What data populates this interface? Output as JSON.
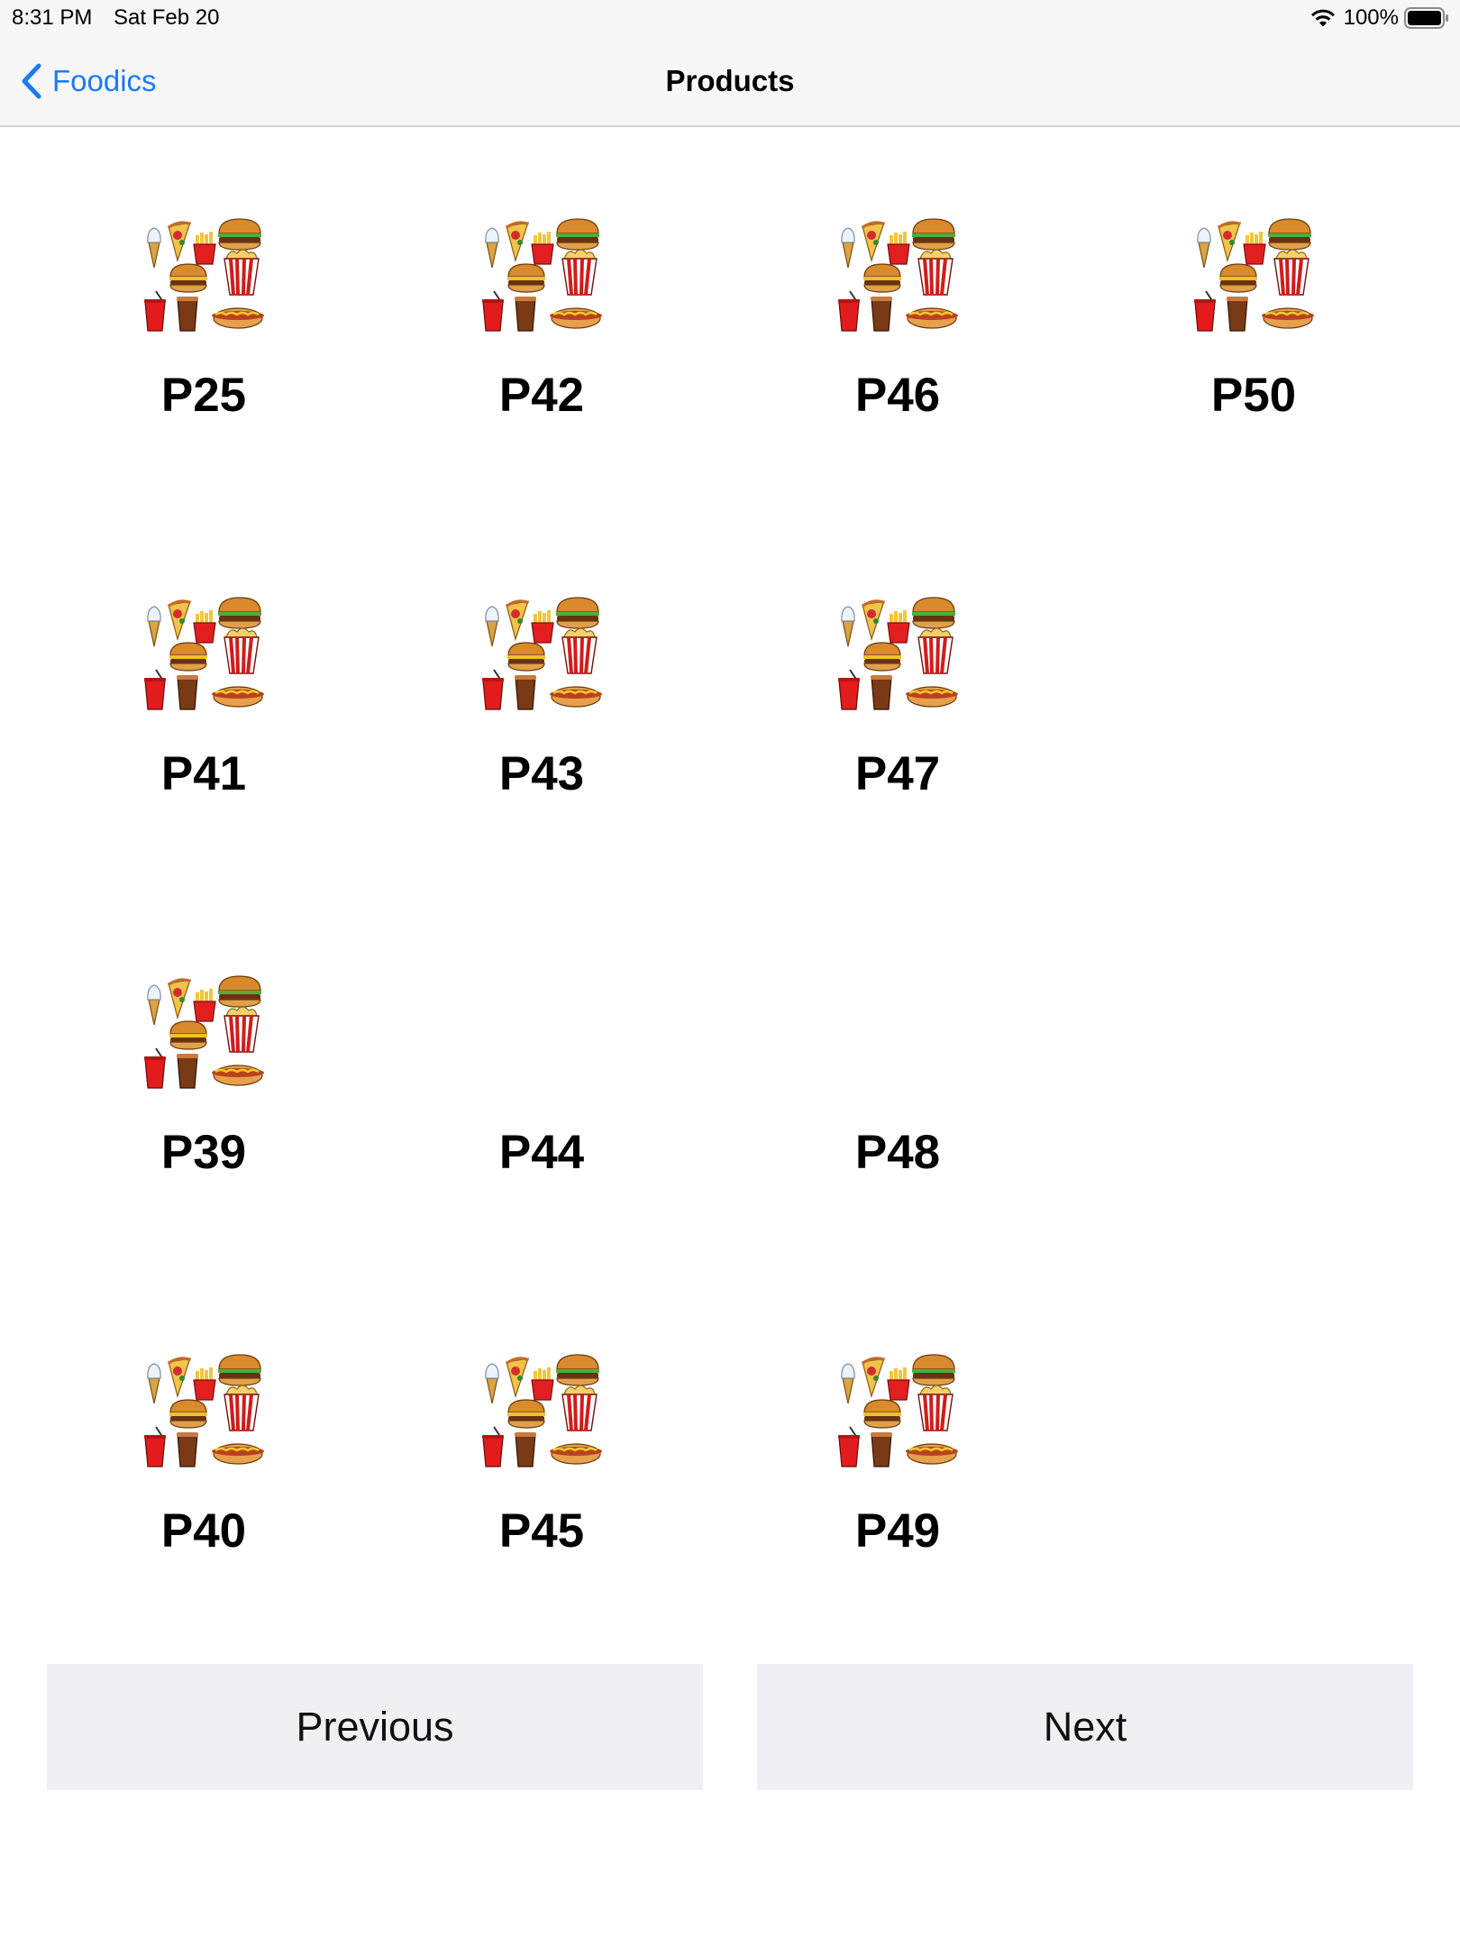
{
  "status_bar": {
    "time": "8:31 PM",
    "date": "Sat Feb 20",
    "battery_percent": "100%",
    "icons": [
      "wifi-icon",
      "battery-icon"
    ]
  },
  "nav_bar": {
    "back_label": "Foodics",
    "title": "Products",
    "accent_color": "#1a7cf6"
  },
  "products": [
    {
      "name": "P25",
      "has_image": true
    },
    {
      "name": "P42",
      "has_image": true
    },
    {
      "name": "P46",
      "has_image": true
    },
    {
      "name": "P50",
      "has_image": true
    },
    {
      "name": "P41",
      "has_image": true
    },
    {
      "name": "P43",
      "has_image": true
    },
    {
      "name": "P47",
      "has_image": true
    },
    {
      "name": "P39",
      "has_image": true
    },
    {
      "name": "P44",
      "has_image": false
    },
    {
      "name": "P48",
      "has_image": false
    },
    {
      "name": "P40",
      "has_image": true
    },
    {
      "name": "P45",
      "has_image": true
    },
    {
      "name": "P49",
      "has_image": true
    }
  ],
  "pager": {
    "previous_label": "Previous",
    "next_label": "Next"
  }
}
